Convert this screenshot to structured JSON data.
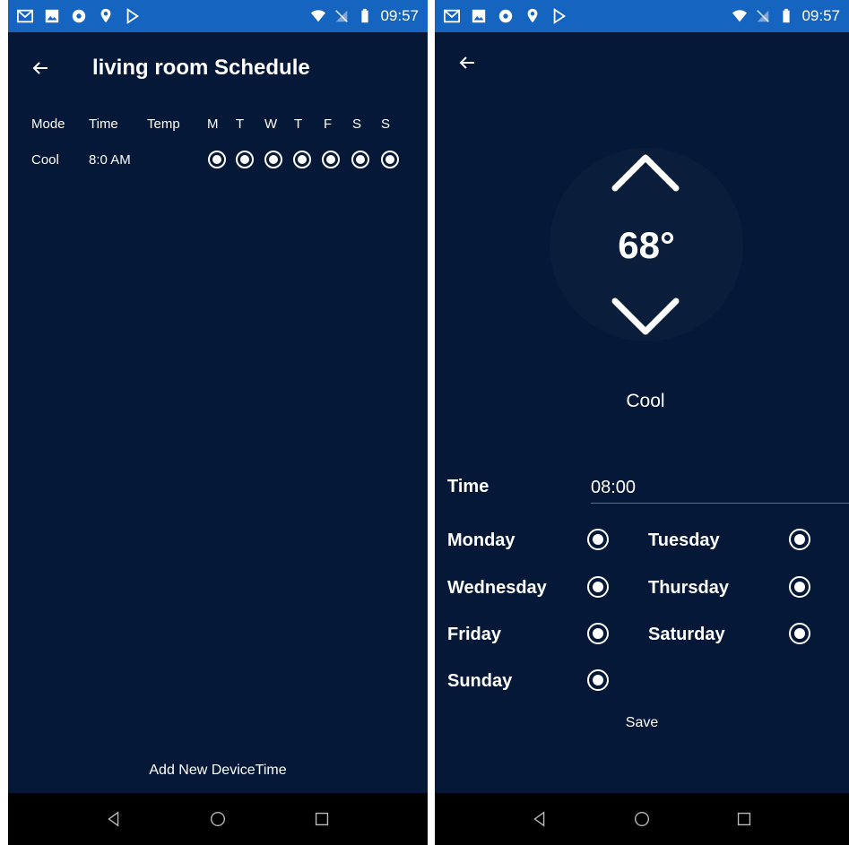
{
  "status_bar": {
    "time": "09:57",
    "left_icons": [
      "gmail-icon",
      "image-icon",
      "soccer-ball-icon",
      "location-pin-icon",
      "play-store-icon"
    ],
    "right_icons": [
      "wifi-icon",
      "no-sim-icon",
      "battery-icon"
    ]
  },
  "schedule_screen": {
    "title": "living room Schedule",
    "columns": {
      "mode": "Mode",
      "time": "Time",
      "temp": "Temp",
      "days": [
        "M",
        "T",
        "W",
        "T",
        "F",
        "S",
        "S"
      ]
    },
    "rows": [
      {
        "mode": "Cool",
        "time": "8:0 AM",
        "temp": "",
        "days_selected": [
          true,
          true,
          true,
          true,
          true,
          true,
          true
        ]
      }
    ],
    "add_new_label": "Add New DeviceTime"
  },
  "edit_screen": {
    "temperature": "68°",
    "mode": "Cool",
    "time_label": "Time",
    "time_value": "08:00",
    "days": [
      {
        "label": "Monday",
        "selected": true
      },
      {
        "label": "Tuesday",
        "selected": true
      },
      {
        "label": "Wednesday",
        "selected": true
      },
      {
        "label": "Thursday",
        "selected": true
      },
      {
        "label": "Friday",
        "selected": true
      },
      {
        "label": "Saturday",
        "selected": true
      },
      {
        "label": "Sunday",
        "selected": true
      }
    ],
    "save_label": "Save"
  },
  "colors": {
    "background": "#061838",
    "status_bar": "#1565c0",
    "nav_bar": "#000000",
    "temp_circle": "#0a1e3c",
    "text": "#ffffff"
  }
}
